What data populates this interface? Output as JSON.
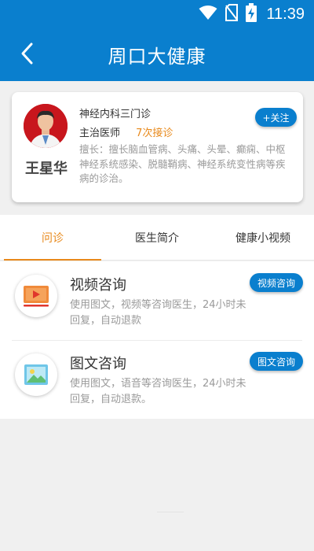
{
  "status_bar": {
    "time": "11:39",
    "icons": [
      "wifi-icon",
      "no-sim-icon",
      "battery-charging-icon"
    ]
  },
  "app_bar": {
    "back_icon": "chevron-left-icon",
    "title": "周口大健康"
  },
  "doctor": {
    "name": "王星华",
    "department": "神经内科三门诊",
    "title": "主治医师",
    "consult_count": "7次接诊",
    "specialty": "擅长：擅长脑血管病、头痛、头晕、癫痫、中枢神经系统感染、脱髓鞘病、神经系统变性病等疾病的诊治。",
    "follow_label": "+关注",
    "avatar_bg": "#c8161d"
  },
  "tabs": [
    {
      "label": "问诊",
      "active": true
    },
    {
      "label": "医生简介",
      "active": false
    },
    {
      "label": "健康小视频",
      "active": false
    }
  ],
  "consultations": [
    {
      "title": "视频咨询",
      "description": "使用图文，视频等咨询医生，24小时未回复，自动退款",
      "button": "视频咨询",
      "icon": "video-play-icon"
    },
    {
      "title": "图文咨询",
      "description": "使用图文，语音等咨询医生，24小时未回复，自动退款。",
      "button": "图文咨询",
      "icon": "image-icon"
    }
  ],
  "colors": {
    "primary": "#0a7fce",
    "accent": "#e8891b",
    "background": "#f0f0f0"
  }
}
